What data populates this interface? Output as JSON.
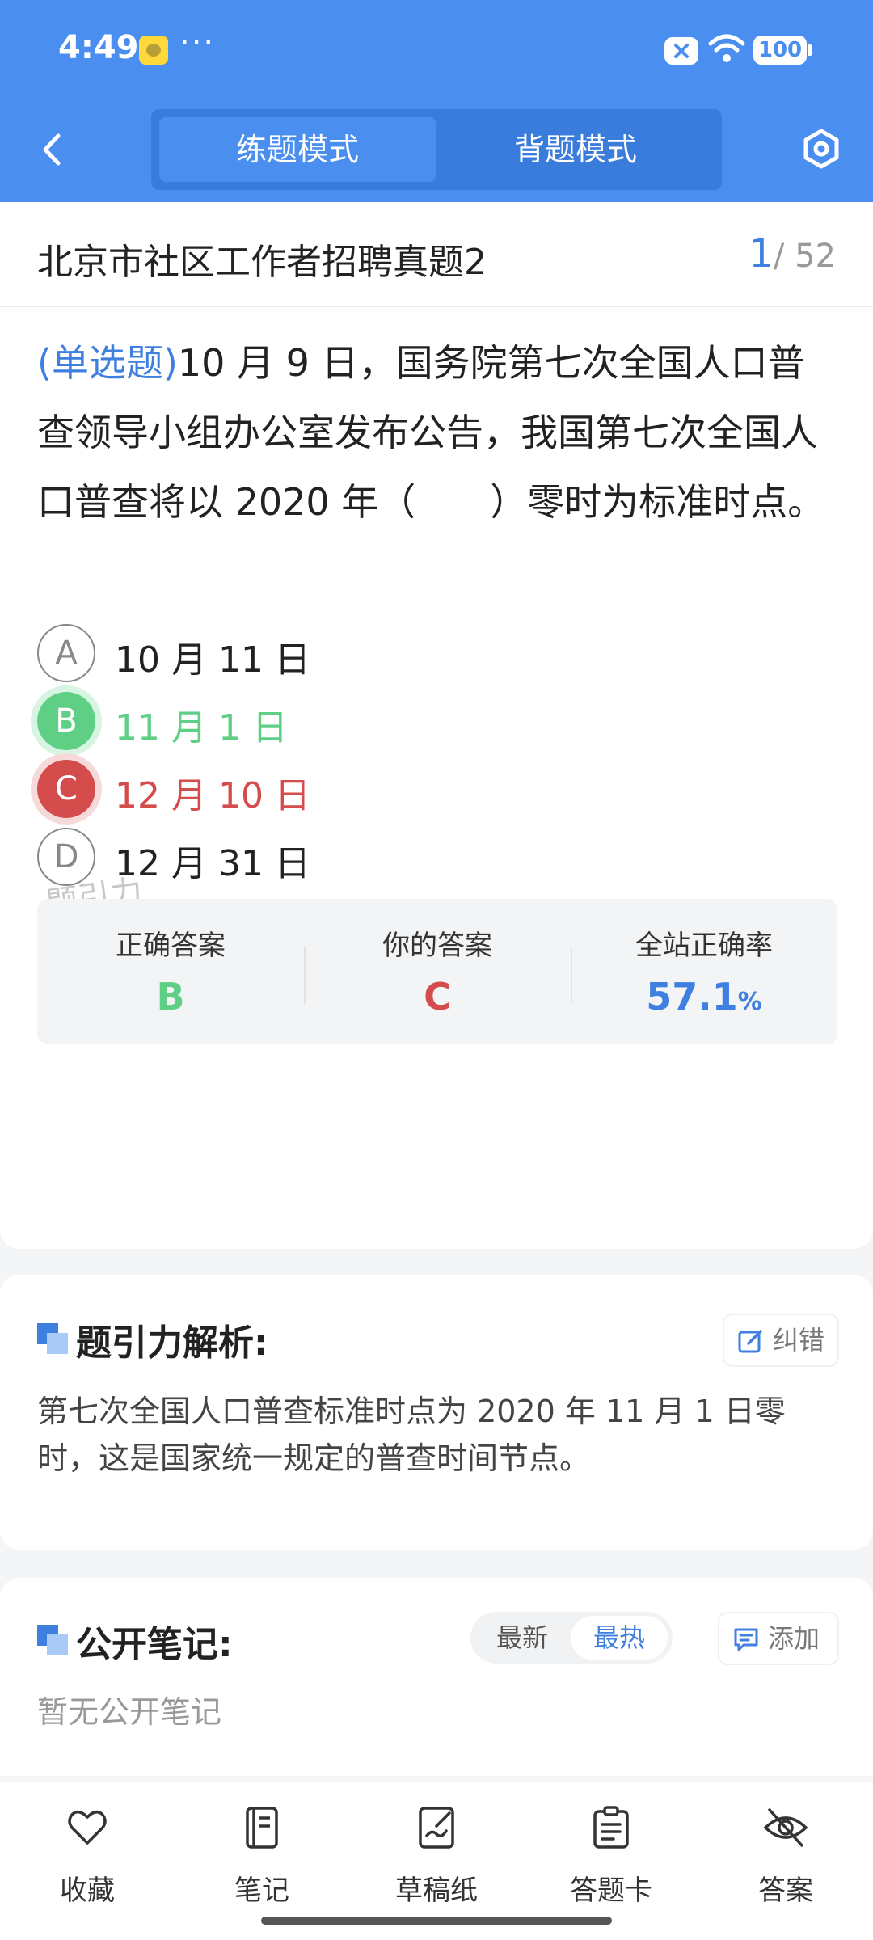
{
  "status_bar": {
    "time": "4:49",
    "dots": "···",
    "battery": "100"
  },
  "header": {
    "tabs": [
      {
        "label": "练题模式",
        "active": true
      },
      {
        "label": "背题模式",
        "active": false
      }
    ]
  },
  "paper": {
    "title": "北京市社区工作者招聘真题2",
    "current": "1",
    "total_text": "/ 52"
  },
  "question": {
    "type_label": "(单选题)",
    "text": "10 月 9 日，国务院第七次全国人口普查领导小组办公室发布公告，我国第七次全国人口普查将以 2020 年（　　）零时为标准时点。"
  },
  "options": [
    {
      "letter": "A",
      "text": "10 月 11 日",
      "state": "normal"
    },
    {
      "letter": "B",
      "text": "11 月 1 日",
      "state": "correct"
    },
    {
      "letter": "C",
      "text": "12 月 10 日",
      "state": "wrong"
    },
    {
      "letter": "D",
      "text": "12 月 31 日",
      "state": "normal"
    }
  ],
  "watermark": "题引力",
  "stats": {
    "correct_label": "正确答案",
    "correct_value": "B",
    "yours_label": "你的答案",
    "yours_value": "C",
    "rate_label": "全站正确率",
    "rate_value": "57.1",
    "rate_unit": "%"
  },
  "analysis": {
    "title": "题引力解析:",
    "fix_label": "纠错",
    "text": "第七次全国人口普查标准时点为 2020 年 11 月 1 日零时，这是国家统一规定的普查时间节点。"
  },
  "notes": {
    "title": "公开笔记:",
    "sort_latest": "最新",
    "sort_hot": "最热",
    "add_label": "添加",
    "empty_text": "暂无公开笔记"
  },
  "bottom_nav": [
    {
      "label": "收藏",
      "icon": "heart-icon"
    },
    {
      "label": "笔记",
      "icon": "notebook-icon"
    },
    {
      "label": "草稿纸",
      "icon": "draft-icon"
    },
    {
      "label": "答题卡",
      "icon": "answer-card-icon"
    },
    {
      "label": "答案",
      "icon": "eye-off-icon"
    }
  ],
  "colors": {
    "primary": "#4a8ef0",
    "correct": "#5fcf86",
    "wrong": "#d44c4c",
    "accent_text": "#3f7fe0"
  }
}
